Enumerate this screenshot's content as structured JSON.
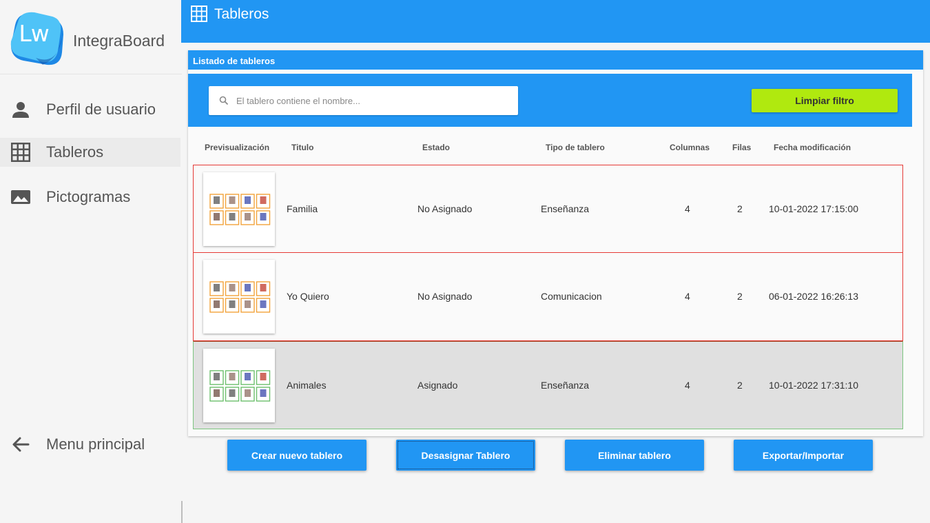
{
  "app": {
    "logo_text": "Lw",
    "name": "IntegraBoard"
  },
  "sidebar": {
    "items": [
      {
        "label": "Perfil de usuario",
        "icon": "person-icon"
      },
      {
        "label": "Tableros",
        "icon": "grid-icon",
        "active": true
      },
      {
        "label": "Pictogramas",
        "icon": "image-icon"
      }
    ],
    "bottom_item": {
      "label": "Menu principal",
      "icon": "arrow-left-icon"
    }
  },
  "header": {
    "title": "Tableros",
    "icon": "grid-icon"
  },
  "card": {
    "title": "Listado de tableros"
  },
  "filter": {
    "search_placeholder": "El tablero contiene el nombre...",
    "search_value": "",
    "clear_label": "Limpiar filtro"
  },
  "table": {
    "columns": [
      "Previsualización",
      "Titulo",
      "Estado",
      "Tipo de tablero",
      "Columnas",
      "Filas",
      "Fecha modificación"
    ],
    "rows": [
      {
        "titulo": "Familia",
        "estado": "No Asignado",
        "tipo": "Enseñanza",
        "columnas": "4",
        "filas": "2",
        "fecha": "10-01-2022 17:15:00",
        "border": "#e53935",
        "tile_border": "#f2a33a"
      },
      {
        "titulo": "Yo Quiero",
        "estado": "No Asignado",
        "tipo": "Comunicacion",
        "columnas": "4",
        "filas": "2",
        "fecha": "06-01-2022 16:26:13",
        "border": "#e53935",
        "tile_border": "#f2a33a"
      },
      {
        "titulo": "Animales",
        "estado": "Asignado",
        "tipo": "Enseñanza",
        "columnas": "4",
        "filas": "2",
        "fecha": "10-01-2022 17:31:10",
        "border": "#7cc57f",
        "tile_border": "#6cbf6c",
        "selected": true
      }
    ]
  },
  "actions": {
    "create": "Crear nuevo tablero",
    "unassign": "Desasignar Tablero",
    "delete": "Eliminar tablero",
    "export_import": "Exportar/Importar"
  },
  "colors": {
    "primary": "#2196f3",
    "clear_button": "#b0e90f",
    "row_border_unassigned": "#e53935",
    "row_border_assigned": "#7cc57f",
    "selected_row_bg": "#e0e0e0"
  }
}
